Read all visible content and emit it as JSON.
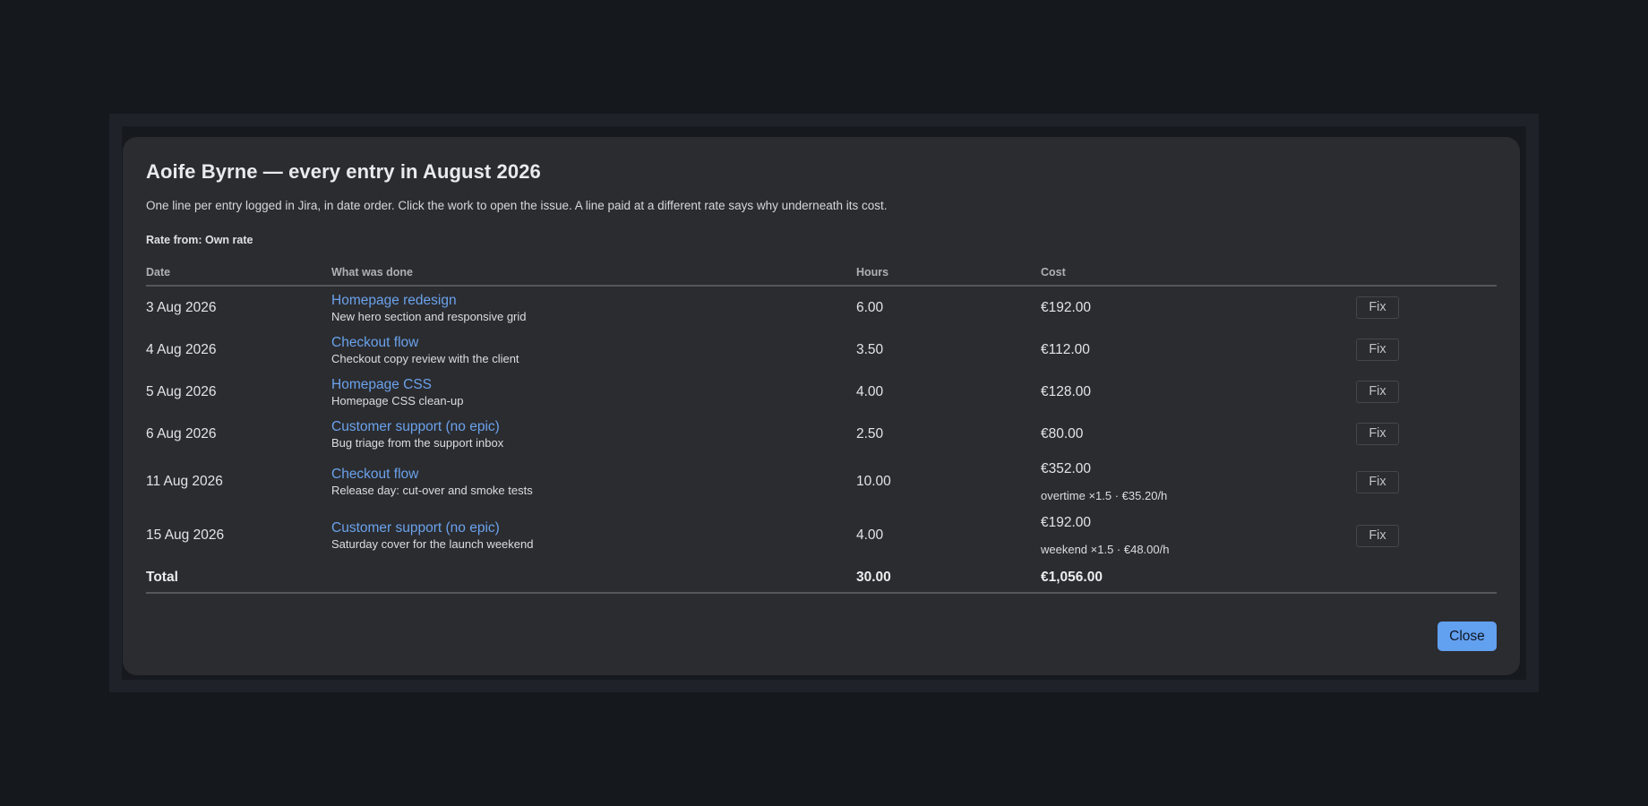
{
  "modal": {
    "title": "Aoife Byrne — every entry in August 2026",
    "description": "One line per entry logged in Jira, in date order. Click the work to open the issue. A line paid at a different rate says why underneath its cost.",
    "rate_from": "Rate from: Own rate",
    "close_label": "Close"
  },
  "table": {
    "headers": {
      "date": "Date",
      "work": "What was done",
      "hours": "Hours",
      "cost": "Cost"
    },
    "fix_label": "Fix",
    "rows": [
      {
        "date": "3 Aug 2026",
        "work": "Homepage redesign",
        "note": "New hero section and responsive grid",
        "hours": "6.00",
        "cost": "€192.00",
        "why": ""
      },
      {
        "date": "4 Aug 2026",
        "work": "Checkout flow",
        "note": "Checkout copy review with the client",
        "hours": "3.50",
        "cost": "€112.00",
        "why": ""
      },
      {
        "date": "5 Aug 2026",
        "work": "Homepage CSS",
        "note": "Homepage CSS clean-up",
        "hours": "4.00",
        "cost": "€128.00",
        "why": ""
      },
      {
        "date": "6 Aug 2026",
        "work": "Customer support (no epic)",
        "note": "Bug triage from the support inbox",
        "hours": "2.50",
        "cost": "€80.00",
        "why": ""
      },
      {
        "date": "11 Aug 2026",
        "work": "Checkout flow",
        "note": "Release day: cut-over and smoke tests",
        "hours": "10.00",
        "cost": "€352.00",
        "why": "overtime ×1.5 · €35.20/h"
      },
      {
        "date": "15 Aug 2026",
        "work": "Customer support (no epic)",
        "note": "Saturday cover for the launch weekend",
        "hours": "4.00",
        "cost": "€192.00",
        "why": "weekend ×1.5 · €48.00/h"
      }
    ],
    "total": {
      "label": "Total",
      "hours": "30.00",
      "cost": "€1,056.00"
    }
  }
}
